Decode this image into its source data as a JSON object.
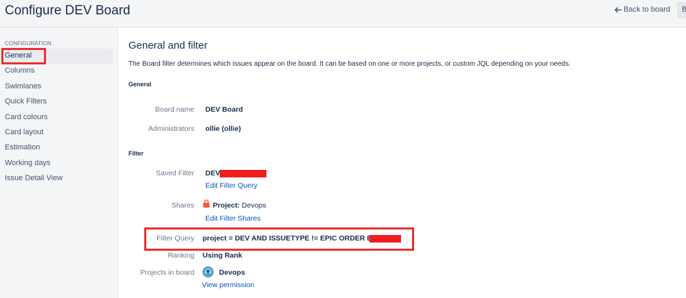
{
  "header": {
    "title": "Configure DEV Board",
    "back_label": "Back to board",
    "button_label": "B"
  },
  "sidebar": {
    "heading": "CONFIGURATION",
    "items": [
      {
        "label": "General"
      },
      {
        "label": "Columns"
      },
      {
        "label": "Swimlanes"
      },
      {
        "label": "Quick Filters"
      },
      {
        "label": "Card colours"
      },
      {
        "label": "Card layout"
      },
      {
        "label": "Estimation"
      },
      {
        "label": "Working days"
      },
      {
        "label": "Issue Detail View"
      }
    ]
  },
  "main": {
    "title": "General and filter",
    "description": "The Board filter determines which issues appear on the board. It can be based on one or more projects, or custom JQL depending on your needs.",
    "general_heading": "General",
    "filter_heading": "Filter",
    "board_name_label": "Board name",
    "board_name": "DEV Board",
    "administrators_label": "Administrators",
    "administrators": "ollie (ollie)",
    "saved_filter_label": "Saved Filter",
    "saved_filter": "DEV",
    "edit_filter_query": "Edit Filter Query",
    "shares_label": "Shares",
    "shares_prefix": "Project:",
    "shares_project": "Devops",
    "edit_filter_shares": "Edit Filter Shares",
    "filter_query_label": "Filter Query",
    "filter_query": "project = DEV AND ISSUETYPE != EPIC ORDER BY",
    "ranking_label": "Ranking",
    "ranking": "Using Rank",
    "projects_label": "Projects in board",
    "project_name": "Devops",
    "view_permission": "View permission"
  },
  "colors": {
    "highlight": "#e8302f",
    "redaction": "#ef1d1d",
    "link": "#0052cc",
    "lock": "#ff5630"
  },
  "icons": {
    "back": "arrow-left-icon",
    "lock": "lock-icon",
    "project": "project-avatar-icon"
  }
}
